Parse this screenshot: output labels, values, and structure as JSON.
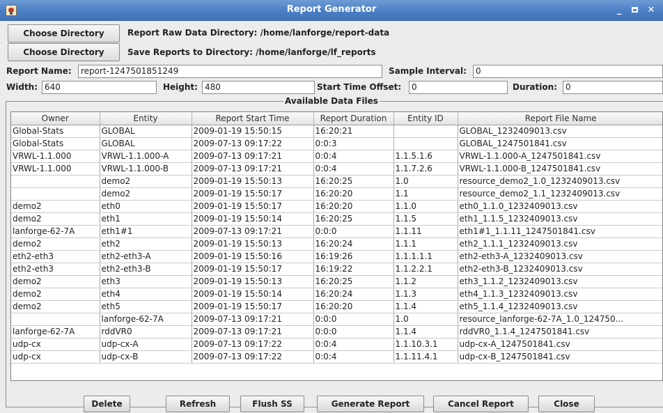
{
  "window": {
    "title": "Report Generator",
    "minimize": "_",
    "close": "✕"
  },
  "directories": {
    "raw": {
      "button": "Choose Directory",
      "label": "Report Raw Data Directory:  /home/lanforge/report-data"
    },
    "save": {
      "button": "Choose Directory",
      "label": "Save Reports to Directory:  /home/lanforge/lf_reports"
    }
  },
  "form": {
    "report_name_label": "Report Name:",
    "report_name_value": "report-1247501851249",
    "sample_interval_label": "Sample Interval:",
    "sample_interval_value": "0",
    "width_label": "Width:",
    "width_value": "640",
    "height_label": "Height:",
    "height_value": "480",
    "start_offset_label": "Start Time Offset:",
    "start_offset_value": "0",
    "duration_label": "Duration:",
    "duration_value": "0"
  },
  "files": {
    "title": "Available Data Files",
    "columns": [
      "Owner",
      "Entity",
      "Report Start Time",
      "Report Duration",
      "Entity ID",
      "Report File Name"
    ],
    "rows": [
      [
        "Global-Stats",
        "GLOBAL",
        "2009-01-19 15:50:15",
        "16:20:21",
        "",
        "GLOBAL_1232409013.csv"
      ],
      [
        "Global-Stats",
        "GLOBAL",
        "2009-07-13 09:17:22",
        "0:0:3",
        "",
        "GLOBAL_1247501841.csv"
      ],
      [
        "VRWL-1.1.000",
        "VRWL-1.1.000-A",
        "2009-07-13 09:17:21",
        "0:0:4",
        "1.1.5.1.6",
        "VRWL-1.1.000-A_1247501841.csv"
      ],
      [
        "VRWL-1.1.000",
        "VRWL-1.1.000-B",
        "2009-07-13 09:17:21",
        "0:0:4",
        "1.1.7.2.6",
        "VRWL-1.1.000-B_1247501841.csv"
      ],
      [
        "",
        "demo2",
        "2009-01-19 15:50:13",
        "16:20:25",
        "1.0",
        "resource_demo2_1.0_1232409013.csv"
      ],
      [
        "",
        "demo2",
        "2009-01-19 15:50:17",
        "16:20:20",
        "1.1",
        "resource_demo2_1.1_1232409013.csv"
      ],
      [
        "demo2",
        "eth0",
        "2009-01-19 15:50:17",
        "16:20:20",
        "1.1.0",
        "eth0_1.1.0_1232409013.csv"
      ],
      [
        "demo2",
        "eth1",
        "2009-01-19 15:50:14",
        "16:20:25",
        "1.1.5",
        "eth1_1.1.5_1232409013.csv"
      ],
      [
        "lanforge-62-7A",
        "eth1#1",
        "2009-07-13 09:17:21",
        "0:0:0",
        "1.1.11",
        "eth1#1_1.1.11_1247501841.csv"
      ],
      [
        "demo2",
        "eth2",
        "2009-01-19 15:50:13",
        "16:20:24",
        "1.1.1",
        "eth2_1.1.1_1232409013.csv"
      ],
      [
        "eth2-eth3",
        "eth2-eth3-A",
        "2009-01-19 15:50:16",
        "16:19:26",
        "1.1.1.1.1",
        "eth2-eth3-A_1232409013.csv"
      ],
      [
        "eth2-eth3",
        "eth2-eth3-B",
        "2009-01-19 15:50:17",
        "16:19:22",
        "1.1.2.2.1",
        "eth2-eth3-B_1232409013.csv"
      ],
      [
        "demo2",
        "eth3",
        "2009-01-19 15:50:13",
        "16:20:25",
        "1.1.2",
        "eth3_1.1.2_1232409013.csv"
      ],
      [
        "demo2",
        "eth4",
        "2009-01-19 15:50:14",
        "16:20:24",
        "1.1.3",
        "eth4_1.1.3_1232409013.csv"
      ],
      [
        "demo2",
        "eth5",
        "2009-01-19 15:50:17",
        "16:20:20",
        "1.1.4",
        "eth5_1.1.4_1232409013.csv"
      ],
      [
        "",
        "lanforge-62-7A",
        "2009-07-13 09:17:21",
        "0:0:0",
        "1.0",
        "resource_lanforge-62-7A_1.0_124750..."
      ],
      [
        "lanforge-62-7A",
        "rddVR0",
        "2009-07-13 09:17:21",
        "0:0:0",
        "1.1.4",
        "rddVR0_1.1.4_1247501841.csv"
      ],
      [
        "udp-cx",
        "udp-cx-A",
        "2009-07-13 09:17:22",
        "0:0:4",
        "1.1.10.3.1",
        "udp-cx-A_1247501841.csv"
      ],
      [
        "udp-cx",
        "udp-cx-B",
        "2009-07-13 09:17:22",
        "0:0:4",
        "1.1.11.4.1",
        "udp-cx-B_1247501841.csv"
      ]
    ]
  },
  "buttons": {
    "delete": "Delete",
    "refresh": "Refresh",
    "flush": "Flush SS",
    "generate": "Generate Report",
    "cancel": "Cancel Report",
    "close": "Close"
  }
}
